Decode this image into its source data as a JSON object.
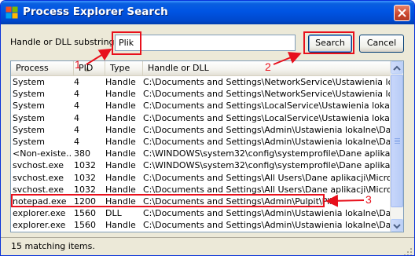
{
  "window": {
    "title": "Process Explorer Search",
    "app_icon": "process-explorer-icon",
    "close_icon": "close-x-icon"
  },
  "search": {
    "label": "Handle or DLL substring:",
    "value": "Plik",
    "search_button": "Search",
    "cancel_button": "Cancel"
  },
  "table": {
    "columns": [
      "Process",
      "PID",
      "Type",
      "Handle or DLL"
    ],
    "rows": [
      {
        "process": "System",
        "pid": "4",
        "type": "Handle",
        "handle": "C:\\Documents and Settings\\NetworkService\\Ustawienia lok..."
      },
      {
        "process": "System",
        "pid": "4",
        "type": "Handle",
        "handle": "C:\\Documents and Settings\\NetworkService\\Ustawienia lok..."
      },
      {
        "process": "System",
        "pid": "4",
        "type": "Handle",
        "handle": "C:\\Documents and Settings\\LocalService\\Ustawienia lokaln..."
      },
      {
        "process": "System",
        "pid": "4",
        "type": "Handle",
        "handle": "C:\\Documents and Settings\\LocalService\\Ustawienia lokaln..."
      },
      {
        "process": "System",
        "pid": "4",
        "type": "Handle",
        "handle": "C:\\Documents and Settings\\Admin\\Ustawienia lokalne\\Dan..."
      },
      {
        "process": "System",
        "pid": "4",
        "type": "Handle",
        "handle": "C:\\Documents and Settings\\Admin\\Ustawienia lokalne\\Dan..."
      },
      {
        "process": "<Non-existe...",
        "pid": "380",
        "type": "Handle",
        "handle": "C:\\WINDOWS\\system32\\config\\systemprofile\\Dane aplikac..."
      },
      {
        "process": "svchost.exe",
        "pid": "1032",
        "type": "Handle",
        "handle": "C:\\WINDOWS\\system32\\config\\systemprofile\\Dane aplikac..."
      },
      {
        "process": "svchost.exe",
        "pid": "1032",
        "type": "Handle",
        "handle": "C:\\Documents and Settings\\All Users\\Dane aplikacji\\Micros..."
      },
      {
        "process": "svchost.exe",
        "pid": "1032",
        "type": "Handle",
        "handle": "C:\\Documents and Settings\\All Users\\Dane aplikacji\\Micros..."
      },
      {
        "process": "notepad.exe",
        "pid": "1200",
        "type": "Handle",
        "handle": "C:\\Documents and Settings\\Admin\\Pulpit\\Plik"
      },
      {
        "process": "explorer.exe",
        "pid": "1560",
        "type": "DLL",
        "handle": "C:\\Documents and Settings\\Admin\\Ustawienia lokalne\\Dan..."
      },
      {
        "process": "explorer.exe",
        "pid": "1560",
        "type": "Handle",
        "handle": "C:\\Documents and Settings\\Admin\\Ustawienia lokalne\\Dan..."
      }
    ]
  },
  "status": {
    "text": "15 matching items."
  },
  "annotations": {
    "color": "#e8101c",
    "labels": [
      "1",
      "2",
      "3"
    ]
  }
}
